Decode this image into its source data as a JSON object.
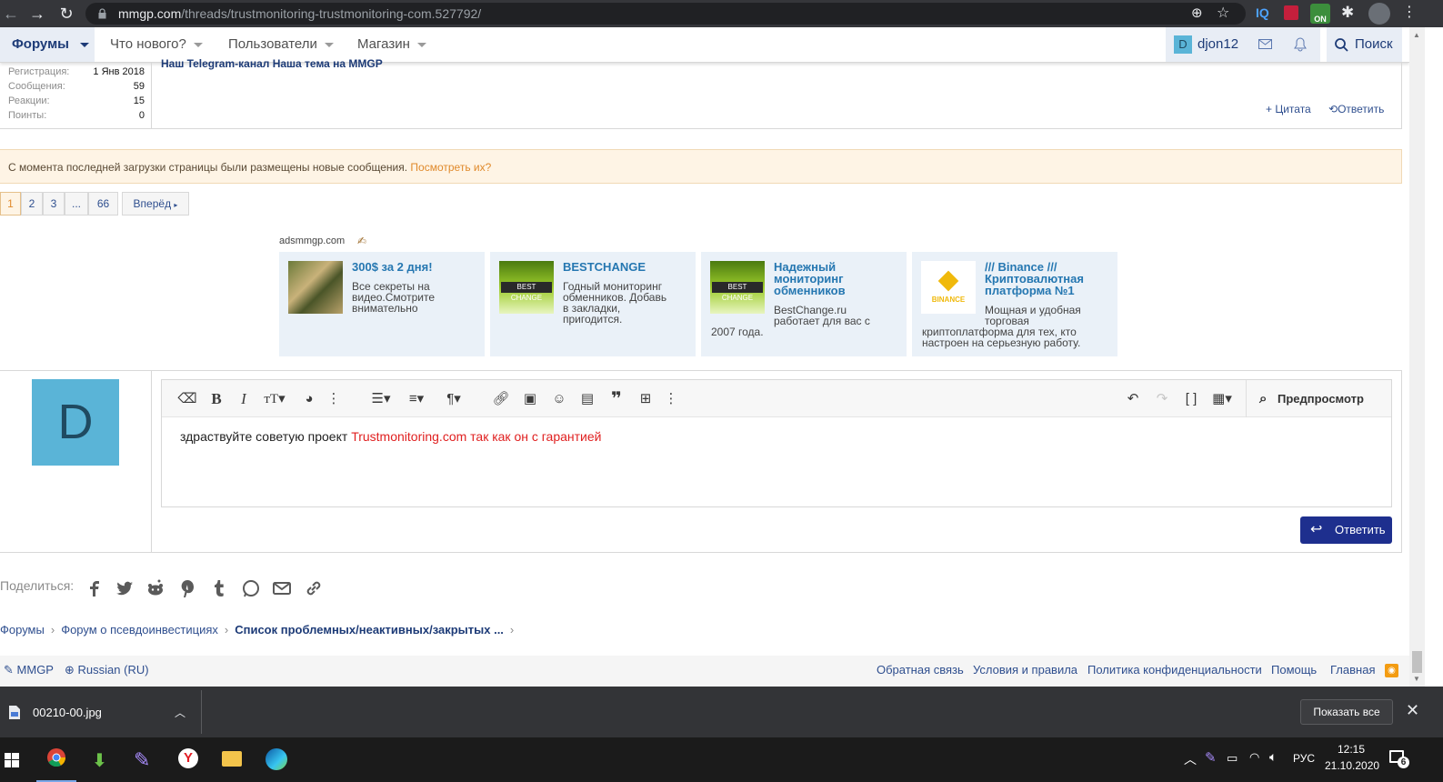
{
  "browser": {
    "url_host": "mmgp.com",
    "url_path": "/threads/trustmonitoring-trustmonitoring-com.527792/"
  },
  "nav": {
    "forums": "Форумы",
    "whats_new": "Что нового?",
    "users": "Пользователи",
    "shop": "Магазин",
    "user_initial": "D",
    "username": "djon12",
    "search": "Поиск"
  },
  "post_user_stats": [
    {
      "label": "Регистрация:",
      "value": "1 Янв 2018"
    },
    {
      "label": "Сообщения:",
      "value": "59"
    },
    {
      "label": "Реакции:",
      "value": "15"
    },
    {
      "label": "Поинты:",
      "value": "0"
    }
  ],
  "post": {
    "signature": "Наш Telegram-канал Наша тема на MMGP",
    "quote": "Цитата",
    "reply": "Ответить"
  },
  "notice": {
    "text": "С момента последней загрузки страницы были размещены новые сообщения.",
    "link": "Посмотреть их?"
  },
  "pager": {
    "pages": [
      "1",
      "2",
      "3",
      "...",
      "66"
    ],
    "next": "Вперёд"
  },
  "ads": {
    "label": "adsmmgp.com",
    "items": [
      {
        "title": "300$ за 2 дня!",
        "desc": [
          "Все секреты на",
          "видео.Смотрите",
          "внимательно"
        ]
      },
      {
        "title": "BESTCHANGE",
        "desc": [
          "Годный мониторинг",
          "обменников. Добавь",
          "в закладки,",
          "пригодится."
        ]
      },
      {
        "title_lines": [
          "Надежный",
          "мониторинг",
          "обменников"
        ],
        "desc": [
          "BestChange.ru",
          "работает для вас с",
          "2007 года."
        ]
      },
      {
        "title_lines": [
          "/// Binance ///",
          "Криптовалютная",
          "платформа №1"
        ],
        "desc": [
          "Мощная и удобная",
          "торговая",
          "криптоплатформа для тех, кто",
          "настроен на серьезную работу."
        ]
      }
    ],
    "badge_text": "BEST CHANGE",
    "binance_text": "BINANCE"
  },
  "editor": {
    "avatar_letter": "D",
    "preview": "Предпросмотр",
    "message_plain": "здраствуйте советую проект ",
    "message_red": "Trustmonitoring.com так как он с гарантией",
    "submit": "Ответить"
  },
  "share": {
    "label": "Поделиться:"
  },
  "breadcrumb": [
    "Форумы",
    "Форум о псевдоинвестициях",
    "Список проблемных/неактивных/закрытых ..."
  ],
  "footer": {
    "left": [
      "MMGP",
      "Russian (RU)"
    ],
    "links": [
      "Обратная связь",
      "Условия и правила",
      "Политика конфиденциальности",
      "Помощь",
      "Главная"
    ]
  },
  "downloads": {
    "file": "00210-00.jpg",
    "show_all": "Показать все"
  },
  "taskbar": {
    "lang": "РУС",
    "time": "12:15",
    "date": "21.10.2020",
    "notif_count": "6",
    "ext_badge": "ON"
  }
}
